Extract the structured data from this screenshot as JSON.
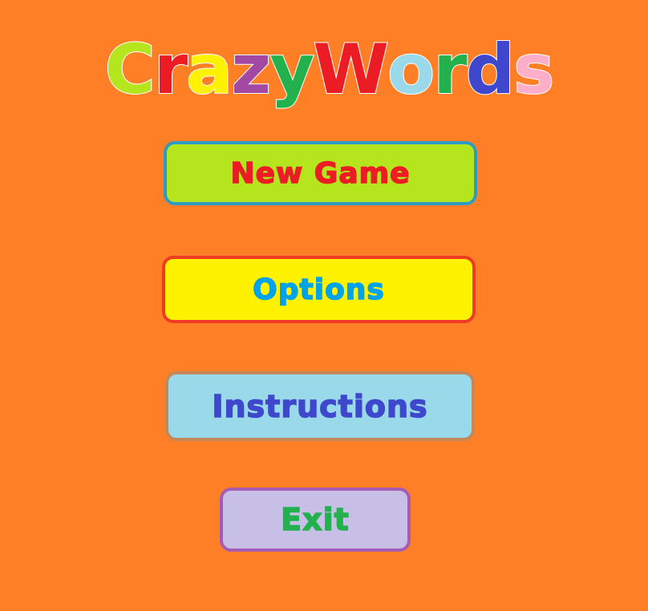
{
  "title": {
    "letters": [
      {
        "char": "C",
        "color": "#B5E61D"
      },
      {
        "char": "r",
        "color": "#EC1C24"
      },
      {
        "char": "a",
        "color": "#FFF200"
      },
      {
        "char": "z",
        "color": "#A349A4"
      },
      {
        "char": "y",
        "color": "#22B14C"
      },
      {
        "char": " ",
        "color": ""
      },
      {
        "char": "W",
        "color": "#EC1C24"
      },
      {
        "char": "o",
        "color": "#99D9EA"
      },
      {
        "char": "r",
        "color": "#22B14C"
      },
      {
        "char": "d",
        "color": "#3F48CC"
      },
      {
        "char": "s",
        "color": "#FFAEC9"
      }
    ]
  },
  "menu": {
    "new_game": {
      "label": "New Game",
      "bg": "#B5E61D",
      "text_color": "#EC1C24"
    },
    "options": {
      "label": "Options",
      "bg": "#FFF200",
      "text_color": "#00A2E8"
    },
    "instructions": {
      "label": "Instructions",
      "bg": "#99D9EA",
      "text_color": "#3F48CC"
    },
    "exit": {
      "label": "Exit",
      "bg": "#C8BFE7",
      "text_color": "#22B14C"
    }
  },
  "colors": {
    "background": "#FF7F27"
  }
}
